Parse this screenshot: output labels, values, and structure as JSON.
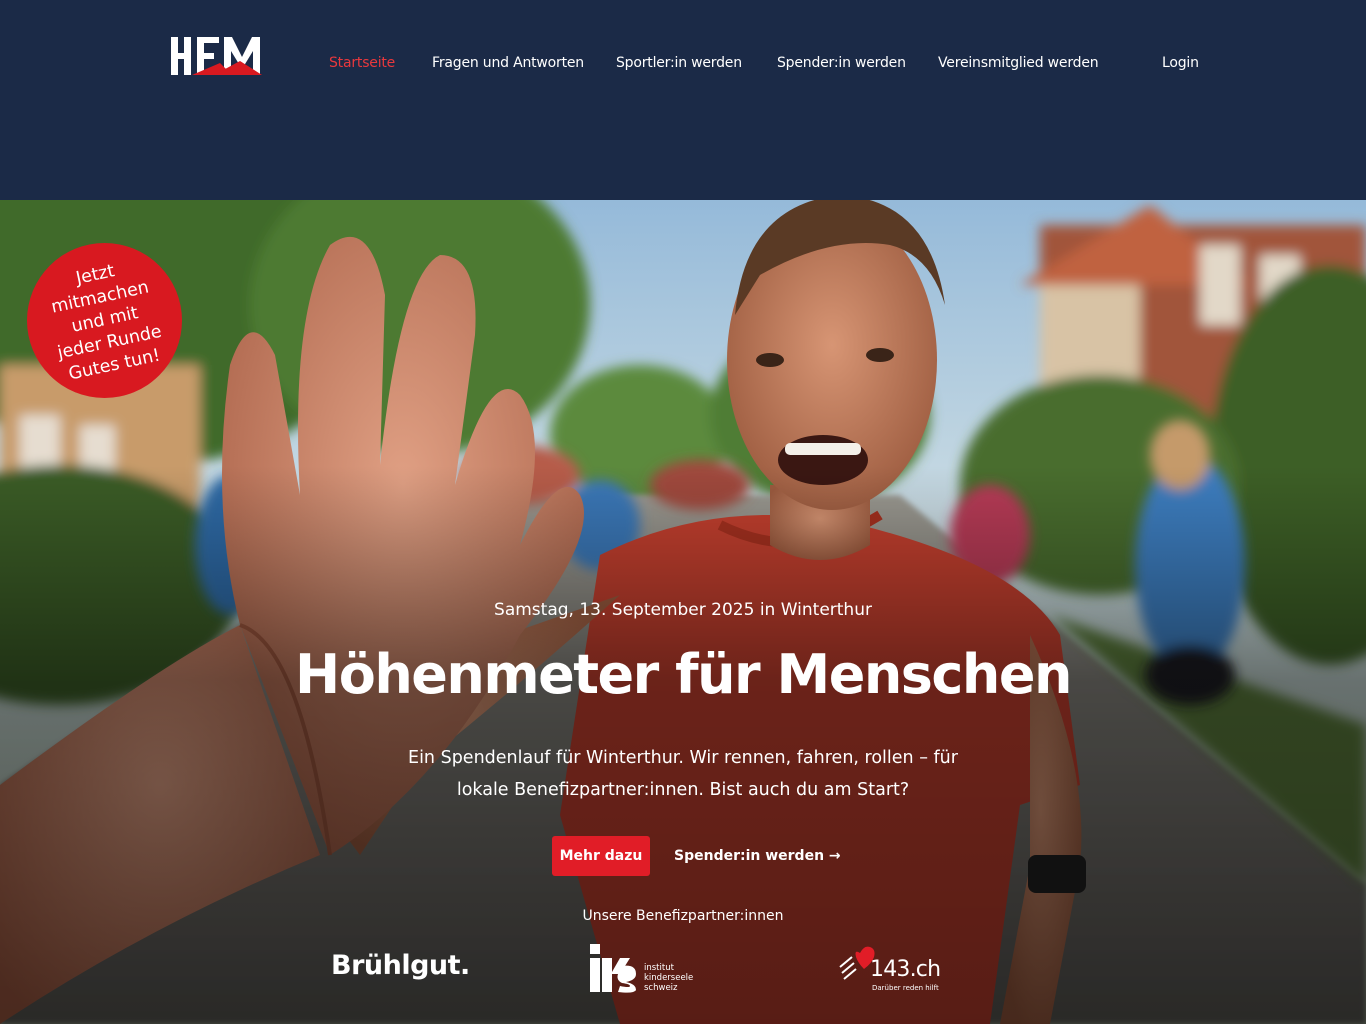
{
  "header": {
    "logo_text": "HFM",
    "nav": [
      {
        "label": "Startseite",
        "active": true
      },
      {
        "label": "Fragen und Antworten",
        "active": false
      },
      {
        "label": "Sportler:in werden",
        "active": false
      },
      {
        "label": "Spender:in werden",
        "active": false
      },
      {
        "label": "Vereinsmitglied werden",
        "active": false
      },
      {
        "label": "Login",
        "active": false
      }
    ]
  },
  "badge": {
    "line1": "Jetzt",
    "line2": "mitmachen",
    "line3": "und mit",
    "line4": "jeder Runde",
    "line5": "Gutes tun!"
  },
  "hero": {
    "date": "Samstag, 13. September 2025 in Winterthur",
    "title": "Höhenmeter für Menschen",
    "subtitle": "Ein Spendenlauf für Winterthur. Wir rennen, fahren, rollen – für lokale Benefizpartner:innen. Bist auch du am Start?",
    "primary_button": "Mehr dazu",
    "secondary_link": "Spender:in werden →",
    "partners_label": "Unsere Benefizpartner:innen"
  },
  "partners": {
    "p1": "Brühlgut.",
    "p2_line1": "institut",
    "p2_line2": "kinderseele",
    "p2_line3": "schweiz",
    "p3_main": "143.ch",
    "p3_tag": "Darüber reden hilft"
  },
  "colors": {
    "header_bg": "#1b2a47",
    "accent_red": "#e11d27",
    "active_nav": "#e8383d"
  }
}
